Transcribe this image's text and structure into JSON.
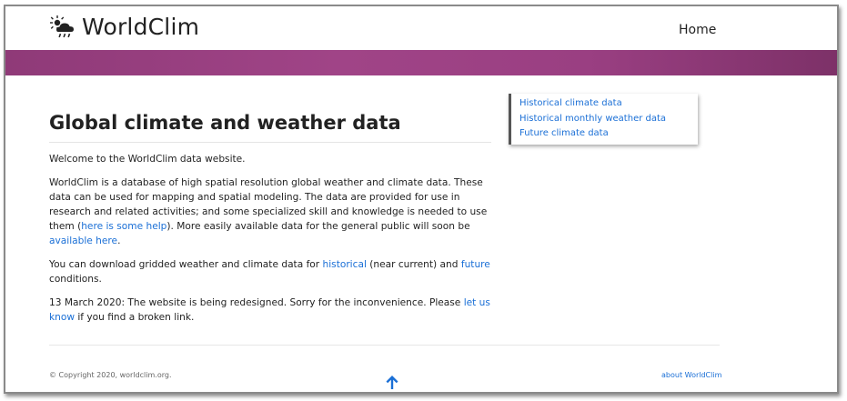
{
  "header": {
    "logo_icon": "cloud-sun-rain-icon",
    "brand": "WorldClim",
    "nav_home": "Home"
  },
  "colors": {
    "banner": "#9a3f82",
    "link": "#1a6fd6",
    "text": "#222222"
  },
  "main": {
    "title": "Global climate and weather data",
    "welcome": "Welcome to the WorldClim data website.",
    "p2": {
      "text1": "WorldClim is a database of high spatial resolution global weather and climate data. These data can be used for mapping and spatial modeling. The data are provided for use in research and related activities; and some specialized skill and knowledge is needed to use them (",
      "link1": "here is some help",
      "text2": "). More easily available data for the general public will soon be ",
      "link2": "available here",
      "text3": "."
    },
    "p3": {
      "text1": "You can download gridded weather and climate data for ",
      "link1": "historical",
      "text2": " (near current) and ",
      "link2": "future",
      "text3": " conditions."
    },
    "p4": {
      "text1": "13 March 2020: The website is being redesigned. Sorry for the inconvenience. Please ",
      "link1": "let us know",
      "text2": " if you find a broken link."
    }
  },
  "sidebar": {
    "items": [
      {
        "label": "Historical climate data"
      },
      {
        "label": "Historical monthly weather data"
      },
      {
        "label": "Future climate data"
      }
    ]
  },
  "footer": {
    "copyright": "© Copyright 2020, worldclim.org.",
    "about": "about WorldClim",
    "scroll_icon": "arrow-up-icon"
  }
}
